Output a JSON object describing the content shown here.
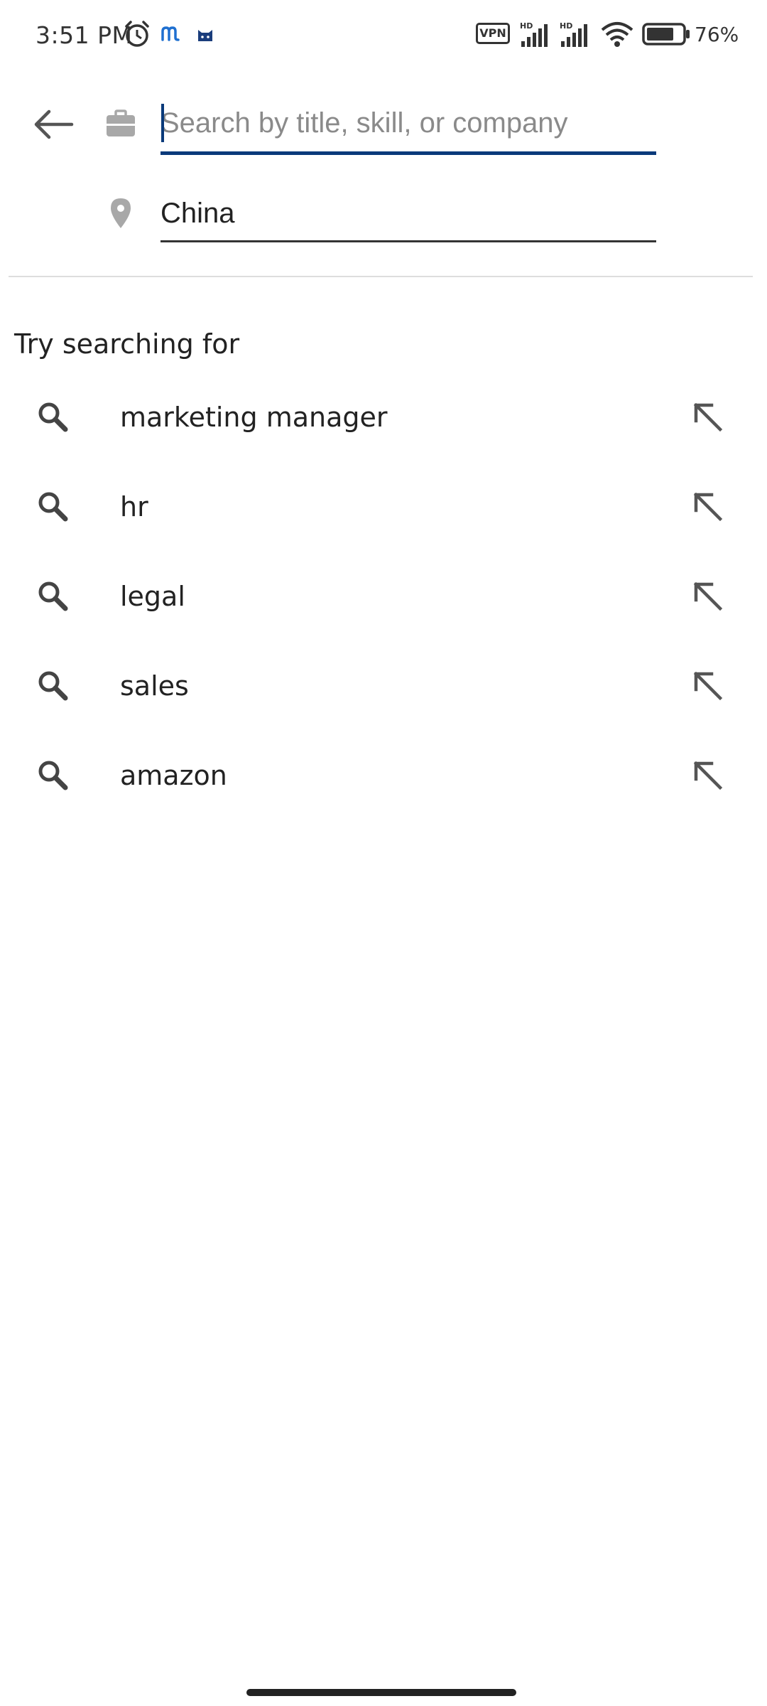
{
  "status_bar": {
    "time": "3:51 PM",
    "vpn": "VPN",
    "battery": "76%",
    "icons": [
      "alarm-icon",
      "m-app-icon",
      "cat-app-icon",
      "signal-hd-icon",
      "signal-hd-icon",
      "wifi-icon",
      "battery-icon"
    ]
  },
  "search": {
    "title_placeholder": "Search by title, skill, or company",
    "title_value": "",
    "location_value": "China",
    "accent_color": "#0a3a7a"
  },
  "suggestions": {
    "heading": "Try searching for",
    "items": [
      {
        "label": "marketing manager"
      },
      {
        "label": "hr"
      },
      {
        "label": "legal"
      },
      {
        "label": "sales"
      },
      {
        "label": "amazon"
      }
    ]
  }
}
